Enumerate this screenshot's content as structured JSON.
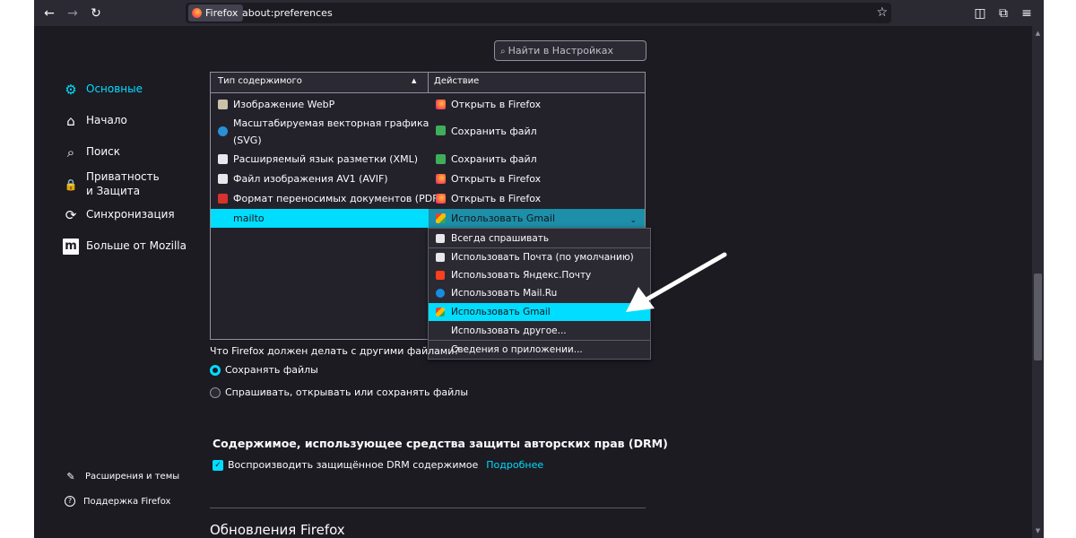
{
  "toolbar": {
    "back": "←",
    "forward": "→",
    "reload": "↻",
    "identity_label": "Firefox",
    "url": "about:preferences",
    "bookmark_star": "☆",
    "pocket": "◫",
    "extensions": "⧉",
    "menu": "≡"
  },
  "search": {
    "placeholder": "Найти в Настройках",
    "icon": "⌕"
  },
  "sidebar": {
    "items": [
      {
        "label": "Основные",
        "icon": "⚙"
      },
      {
        "label": "Начало",
        "icon": "⌂"
      },
      {
        "label": "Поиск",
        "icon": "⌕"
      },
      {
        "label": "Приватность и Защита",
        "icon": "🔒"
      },
      {
        "label": "Синхронизация",
        "icon": "⟳"
      },
      {
        "label": "Больше от Mozilla",
        "icon": "m"
      }
    ],
    "footer": [
      {
        "label": "Расширения и темы",
        "icon": "✎"
      },
      {
        "label": "Поддержка Firefox",
        "icon": "?"
      }
    ]
  },
  "table": {
    "col_type": "Тип содержимого",
    "col_action": "Действие",
    "sort_indicator": "▲",
    "rows": [
      {
        "type": "Изображение WebP",
        "action": "Открыть в Firefox"
      },
      {
        "type": "Масштабируемая векторная графика",
        "type2": "(SVG)",
        "action": "Сохранить файл"
      },
      {
        "type": "Расширяемый язык разметки (XML)",
        "action": "Сохранить файл"
      },
      {
        "type": "Файл изображения AV1 (AVIF)",
        "action": "Открыть в Firefox"
      },
      {
        "type": "Формат переносимых документов (PDF)",
        "action": "Открыть в Firefox"
      },
      {
        "type": "mailto",
        "action": "Использовать Gmail"
      }
    ],
    "chevron": "⌄"
  },
  "dropdown": {
    "items": [
      "Всегда спрашивать",
      "Использовать Почта (по умолчанию)",
      "Использовать Яндекс.Почту",
      "Использовать Mail.Ru",
      "Использовать Gmail",
      "Использовать другое...",
      "Сведения о приложении..."
    ]
  },
  "other_files": {
    "question": "Что Firefox должен делать с другими файлами?",
    "options": [
      "Сохранять файлы",
      "Спрашивать, открывать или сохранять файлы"
    ],
    "selected": 0
  },
  "drm": {
    "title": "Содержимое, использующее средства защиты авторских прав (DRM)",
    "checkbox_label": "Воспроизводить защищённое DRM содержимое",
    "link": "Подробнее",
    "check_mark": "✓"
  },
  "updates": {
    "title": "Обновления Firefox"
  },
  "colors": {
    "accent": "#00ddff",
    "background": "#1c1b22",
    "toolbar": "#2b2a33"
  }
}
